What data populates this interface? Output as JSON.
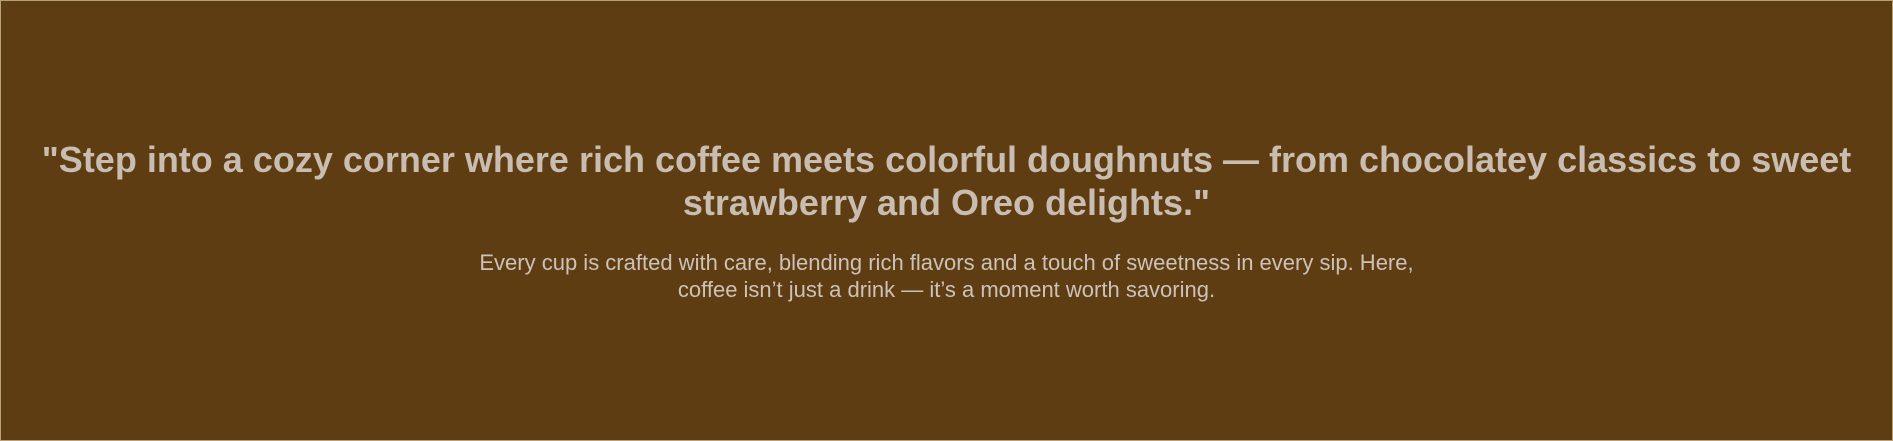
{
  "hero": {
    "headline": "\"Step into a cozy corner where rich coffee meets colorful doughnuts — from chocolatey classics to sweet strawberry and Oreo delights.\"",
    "subtext": "Every cup is crafted with care, blending rich flavors and a touch of sweetness in every sip. Here, coffee isn’t just a drink — it’s a moment worth savoring."
  },
  "colors": {
    "background": "#5e3d12",
    "headline_text": "#c9bdb1",
    "body_text": "#cdc2b8"
  }
}
